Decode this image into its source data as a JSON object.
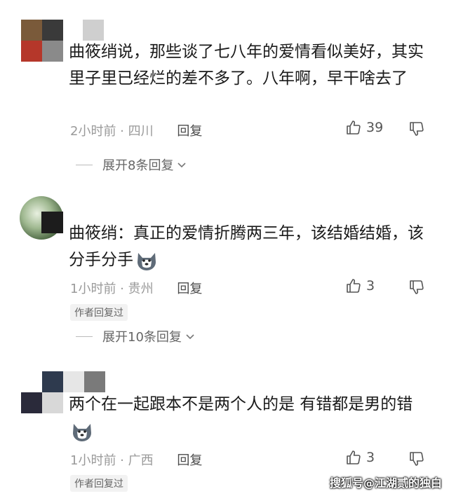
{
  "comments": [
    {
      "text": "曲筱绡说，那些谈了七八年的爱情看似美好，其实里子里已经烂的差不多了。八年啊，早干啥去了",
      "time": "2小时前 · 四川",
      "reply_label": "回复",
      "likes": "39",
      "expand_label": "展开8条回复"
    },
    {
      "text": "曲筱绡：真正的爱情折腾两三年，该结婚结婚，该分手分手",
      "time": "1小时前 · 贵州",
      "reply_label": "回复",
      "likes": "3",
      "author_badge": "作者回复过",
      "expand_label": "展开10条回复"
    },
    {
      "text": "两个在一起跟本不是两个人的是 有错都是男的错",
      "time": "1小时前 · 广西",
      "reply_label": "回复",
      "likes": "3",
      "author_badge": "作者回复过"
    }
  ],
  "watermark": "搜狐号@江湖贰的独白",
  "icons": {
    "like": "thumbs-up-icon",
    "dislike": "thumbs-down-icon",
    "expand": "chevron-down-icon",
    "emoji": "husky-dog-emoji-icon"
  },
  "colors": {
    "meta": "#9a9a9a",
    "text": "#1a1a1a"
  }
}
